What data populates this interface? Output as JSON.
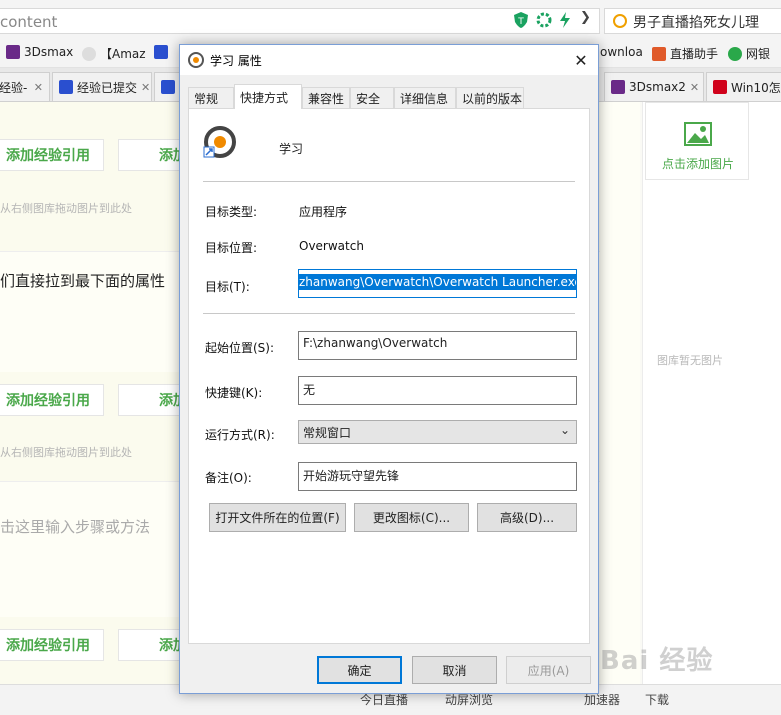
{
  "browser": {
    "address_text": "content",
    "search_text": "男子直播掐死女儿理",
    "bookmarks": [
      "3Dsmax",
      "【Amaz",
      "ownloa",
      "直播助手",
      "网银"
    ],
    "tabs": [
      "经验-",
      "经验已提交",
      "3Dsmax2",
      "Win10怎"
    ]
  },
  "page": {
    "add_ref": "添加经验引用",
    "add_ref_clipped": "添加",
    "drop_hint": "从右侧图库拖动图片到此处",
    "step_text": "们直接拉到最下面的属性",
    "step_placeholder": "击这里输入步骤或方法",
    "add_image": "点击添加图片",
    "no_image": "图库暂无图片",
    "status_items": [
      "今日直播",
      "动屏浏览",
      "加速器",
      "下载"
    ],
    "watermark": "Bai 经验"
  },
  "dialog": {
    "title": "学习 属性",
    "close": "✕",
    "tabs": [
      "常规",
      "快捷方式",
      "兼容性",
      "安全",
      "详细信息",
      "以前的版本"
    ],
    "active_tab": "快捷方式",
    "app_name": "学习",
    "fields": {
      "target_type_label": "目标类型:",
      "target_type_value": "应用程序",
      "target_location_label": "目标位置:",
      "target_location_value": "Overwatch",
      "target_label": "目标(T):",
      "target_value": "zhanwang\\Overwatch\\Overwatch Launcher.exe\"",
      "start_in_label": "起始位置(S):",
      "start_in_value": "F:\\zhanwang\\Overwatch",
      "hotkey_label": "快捷键(K):",
      "hotkey_value": "无",
      "run_label": "运行方式(R):",
      "run_value": "常规窗口",
      "comment_label": "备注(O):",
      "comment_value": "开始游玩守望先锋"
    },
    "buttons": {
      "open_location": "打开文件所在的位置(F)",
      "change_icon": "更改图标(C)...",
      "advanced": "高级(D)...",
      "ok": "确定",
      "cancel": "取消",
      "apply": "应用(A)"
    }
  },
  "colors": {
    "accent": "#0078d7",
    "green": "#4aa84a"
  }
}
